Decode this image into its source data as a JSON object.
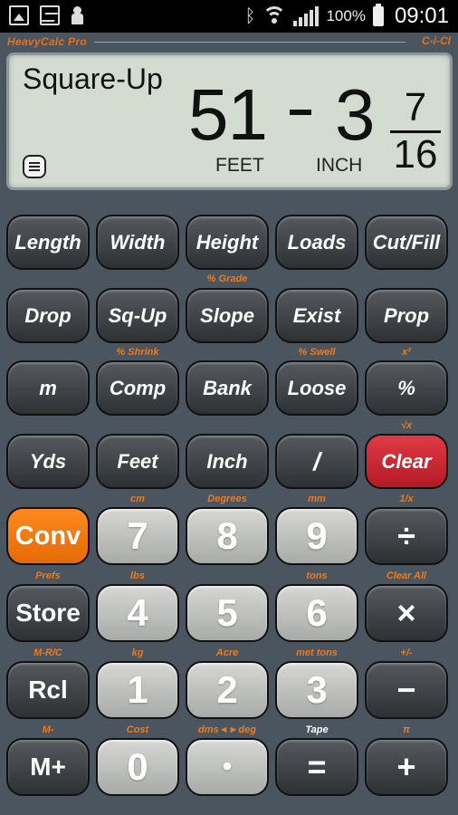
{
  "status_bar": {
    "left_icons": [
      "gallery-icon",
      "voicemail-icon",
      "pawn-icon"
    ],
    "battery_percent": "100%",
    "time": "09:01"
  },
  "brand": {
    "title": "HeavyCalc Pro",
    "right_label": "C-i-CI"
  },
  "display": {
    "mode": "Square-Up",
    "feet_value": "51",
    "inch_value": "3",
    "fraction_numerator": "7",
    "fraction_denominator": "16",
    "feet_unit": "FEET",
    "inch_unit": "INCH"
  },
  "keys": {
    "length": "Length",
    "width": "Width",
    "height": "Height",
    "loads": "Loads",
    "cut_fill": "Cut/Fill",
    "drop": "Drop",
    "sq_up": "Sq-Up",
    "slope": "Slope",
    "exist": "Exist",
    "prop": "Prop",
    "m": "m",
    "comp": "Comp",
    "bank": "Bank",
    "loose": "Loose",
    "percent": "%",
    "yds": "Yds",
    "feet": "Feet",
    "inch": "Inch",
    "slash": "/",
    "clear": "Clear",
    "conv": "Conv",
    "seven": "7",
    "eight": "8",
    "nine": "9",
    "divide": "÷",
    "store": "Store",
    "four": "4",
    "five": "5",
    "six": "6",
    "multiply": "×",
    "rcl": "Rcl",
    "one": "1",
    "two": "2",
    "three": "3",
    "minus": "−",
    "m_plus": "M+",
    "zero": "0",
    "dot": "•",
    "equals": "=",
    "plus": "+"
  },
  "secondary": {
    "slope": "% Grade",
    "comp": "% Shrink",
    "loose": "% Swell",
    "percent": "x²",
    "clear": "√x",
    "seven": "cm",
    "eight": "Degrees",
    "nine": "mm",
    "divide": "1/x",
    "store": "Prefs",
    "four": "lbs",
    "six": "tons",
    "multiply": "Clear All",
    "rcl": "M-R/C",
    "one": "kg",
    "two": "Acre",
    "three": "met tons",
    "minus": "+/-",
    "m_plus": "M-",
    "zero": "Cost",
    "dot": "dms◄►deg",
    "equals": "Tape",
    "plus": "π"
  },
  "colors": {
    "accent_orange": "#ff8a1f",
    "clear_red": "#d42a36",
    "lcd_background": "#d4dcd2",
    "panel_background": "#4a5560"
  }
}
